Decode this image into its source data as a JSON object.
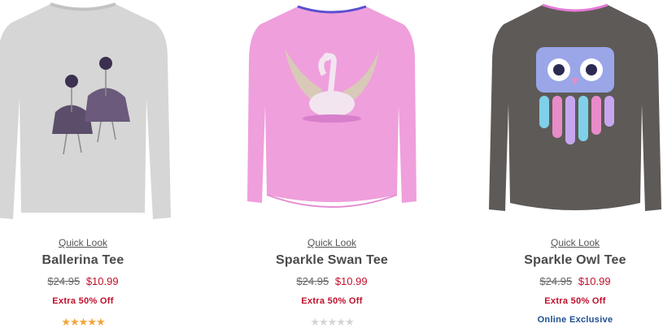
{
  "products": [
    {
      "quick_look": "Quick Look",
      "name": "Ballerina Tee",
      "was_price": "$24.95",
      "sale_price": "$10.99",
      "promo": "Extra 50% Off",
      "rating": 5,
      "rating_max": 5,
      "shirt_color": "#d6d6d6",
      "image_subject": "two ballerinas"
    },
    {
      "quick_look": "Quick Look",
      "name": "Sparkle Swan Tee",
      "was_price": "$24.95",
      "sale_price": "$10.99",
      "promo": "Extra 50% Off",
      "rating": 0,
      "rating_max": 5,
      "shirt_color": "#ef9fdc",
      "image_subject": "sequin swan"
    },
    {
      "quick_look": "Quick Look",
      "name": "Sparkle Owl Tee",
      "was_price": "$24.95",
      "sale_price": "$10.99",
      "promo": "Extra 50% Off",
      "badge": "Online Exclusive",
      "shirt_color": "#5e5a58",
      "image_subject": "sequin owl"
    }
  ],
  "colors": {
    "sale": "#c0102b",
    "star": "#f2a53a",
    "exclusive": "#1f4e8f"
  }
}
